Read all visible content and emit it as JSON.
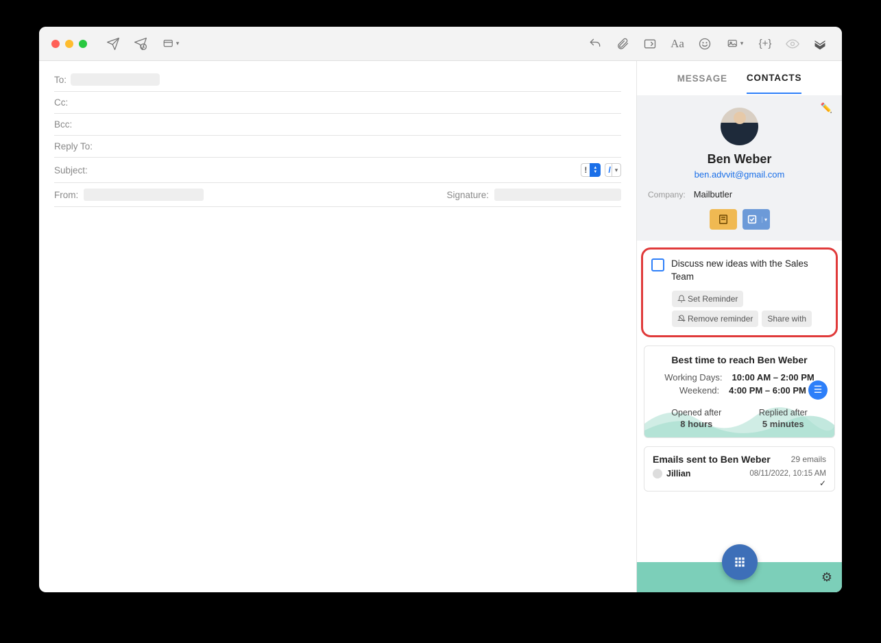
{
  "compose": {
    "to_label": "To:",
    "cc_label": "Cc:",
    "bcc_label": "Bcc:",
    "reply_label": "Reply To:",
    "subject_label": "Subject:",
    "from_label": "From:",
    "signature_label": "Signature:",
    "priority_symbol": "!",
    "read_receipt_symbol": "//"
  },
  "tabs": {
    "message": "MESSAGE",
    "contacts": "CONTACTS"
  },
  "contact": {
    "name": "Ben Weber",
    "email": "ben.advvit@gmail.com",
    "company_label": "Company:",
    "company": "Mailbutler"
  },
  "task": {
    "text": "Discuss new ideas with the Sales Team",
    "set_reminder": "Set Reminder",
    "remove_reminder": "Remove reminder",
    "share_with": "Share with"
  },
  "best": {
    "title": "Best time to reach Ben Weber",
    "working_label": "Working Days:",
    "working_val": "10:00 AM – 2:00 PM",
    "weekend_label": "Weekend:",
    "weekend_val": "4:00 PM – 6:00 PM",
    "opened_label": "Opened after",
    "opened_val": "8 hours",
    "replied_label": "Replied after",
    "replied_val": "5 minutes"
  },
  "emails": {
    "title": "Emails sent to Ben Weber",
    "count": "29 emails",
    "item": {
      "sender": "Jillian",
      "date": "08/11/2022, 10:15 AM"
    }
  }
}
